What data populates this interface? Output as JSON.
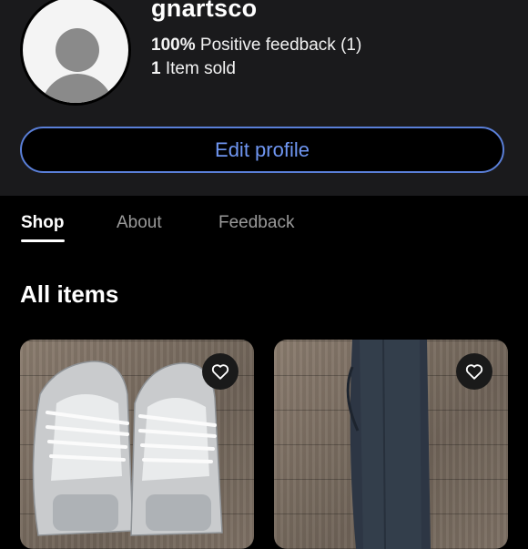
{
  "profile": {
    "username": "gnartsco",
    "feedback_percent": "100%",
    "feedback_text": "Positive feedback (1)",
    "items_sold_count": "1",
    "items_sold_text": "Item sold",
    "edit_button_label": "Edit profile"
  },
  "tabs": [
    {
      "label": "Shop",
      "active": true
    },
    {
      "label": "About",
      "active": false
    },
    {
      "label": "Feedback",
      "active": false
    }
  ],
  "section_title": "All items",
  "items": [
    {
      "icon": "heart-icon"
    },
    {
      "icon": "heart-icon"
    }
  ],
  "colors": {
    "accent": "#6f96f2",
    "header_bg": "#1a1a1c",
    "page_bg": "#000000"
  }
}
